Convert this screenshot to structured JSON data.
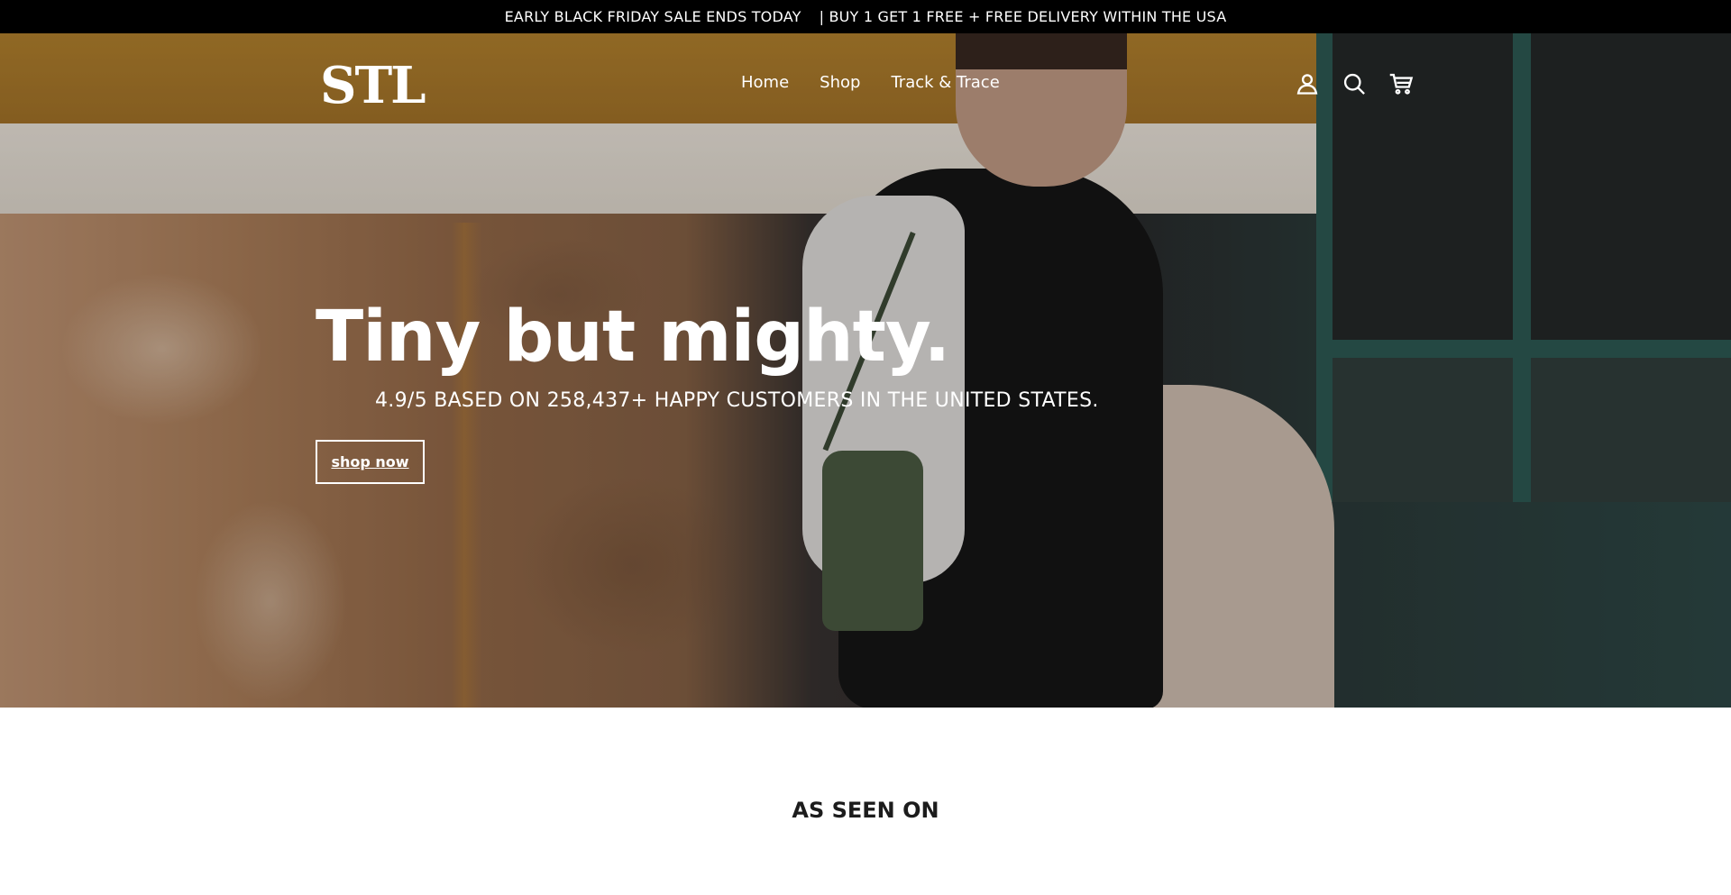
{
  "announcement": {
    "part1": "EARLY BLACK FRIDAY SALE ENDS TODAY",
    "part2": "| BUY 1 GET 1 FREE + FREE DELIVERY WITHIN THE USA"
  },
  "header": {
    "logo": "STL",
    "nav": [
      "Home",
      "Shop",
      "Track & Trace"
    ],
    "icons": [
      "account-icon",
      "search-icon",
      "cart-icon"
    ]
  },
  "hero": {
    "title": "Tiny but mighty.",
    "subtitle": "4.9/5 BASED ON 258,437+ HAPPY CUSTOMERS IN THE UNITED STATES.",
    "button_label": "shop now"
  },
  "as_seen_on": {
    "heading": "AS SEEN ON"
  },
  "colors": {
    "announcement_bg": "#000000",
    "text_light": "#ffffff",
    "text_dark": "#1c1c1c"
  }
}
